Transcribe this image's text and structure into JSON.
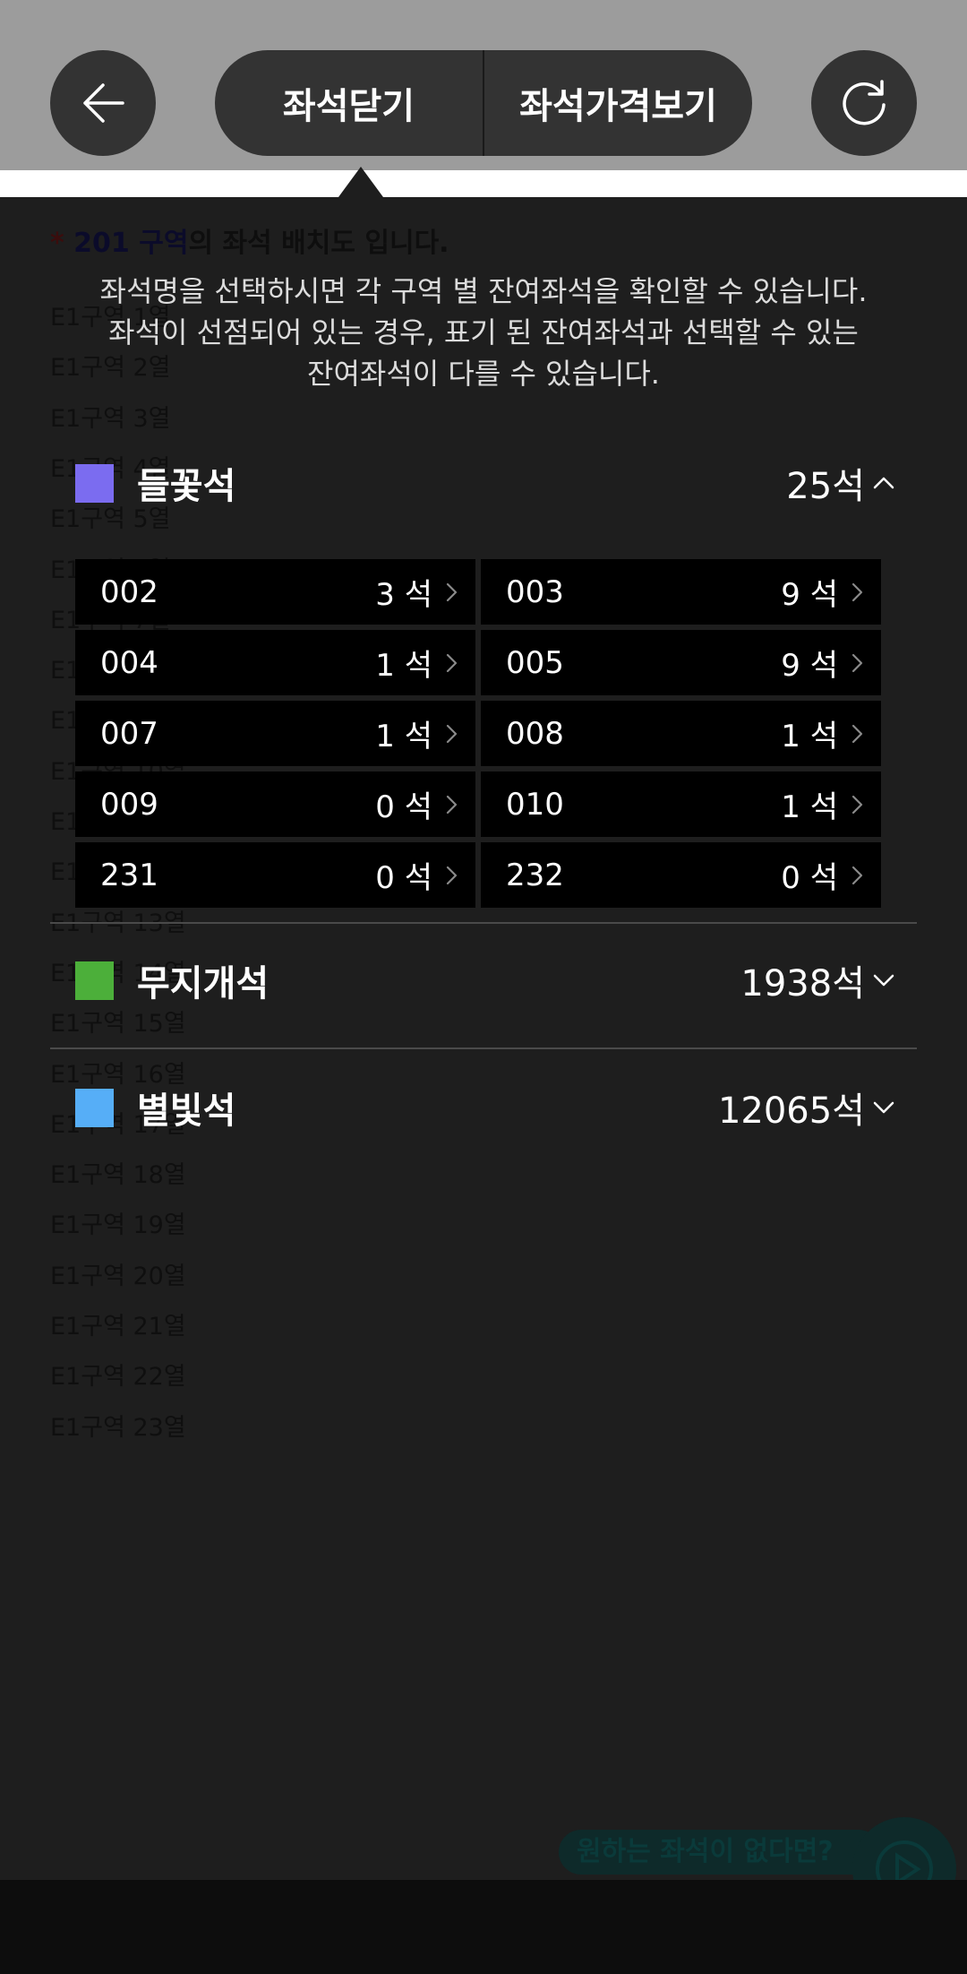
{
  "header": {
    "close_seats_label": "좌석닫기",
    "view_prices_label": "좌석가격보기"
  },
  "background_page": {
    "title_star": "*",
    "title_zone": "201 구역",
    "title_rest": "의 좌석 배치도 입니다.",
    "rows": [
      "E1구역 1열",
      "E1구역 2열",
      "E1구역 3열",
      "E1구역 4열",
      "E1구역 5열",
      "E1구역 6열",
      "E1구역 7열",
      "E1구역 8열",
      "E1구역 9열",
      "E1구역 10열",
      "E1구역 11열",
      "E1구역 12열",
      "E1구역 13열",
      "E1구역 14열",
      "E1구역 15열",
      "E1구역 16열",
      "E1구역 17열",
      "E1구역 18열",
      "E1구역 19열",
      "E1구역 20열",
      "E1구역 21열",
      "E1구역 22열",
      "E1구역 23열"
    ],
    "cta_label": "원하는 좌석이 없다면?"
  },
  "info": {
    "line1": "좌석명을 선택하시면 각 구역 별 잔여좌석을 확인할 수 있습니다.",
    "line2": "좌석이 선점되어 있는 경우, 표기 된 잔여좌석과 선택할 수 있는",
    "line3": "잔여좌석이 다를 수 있습니다."
  },
  "categories": [
    {
      "name": "들꽃석",
      "count": "25석",
      "color": "#7b6cf0",
      "expanded": true,
      "sections": [
        {
          "name": "002",
          "count": "3 석"
        },
        {
          "name": "003",
          "count": "9 석"
        },
        {
          "name": "004",
          "count": "1 석"
        },
        {
          "name": "005",
          "count": "9 석"
        },
        {
          "name": "007",
          "count": "1 석"
        },
        {
          "name": "008",
          "count": "1 석"
        },
        {
          "name": "009",
          "count": "0 석"
        },
        {
          "name": "010",
          "count": "1 석"
        },
        {
          "name": "231",
          "count": "0 석"
        },
        {
          "name": "232",
          "count": "0 석"
        }
      ]
    },
    {
      "name": "무지개석",
      "count": "1938석",
      "color": "#4caf3a",
      "expanded": false
    },
    {
      "name": "별빛석",
      "count": "12065석",
      "color": "#56aef7",
      "expanded": false
    }
  ]
}
